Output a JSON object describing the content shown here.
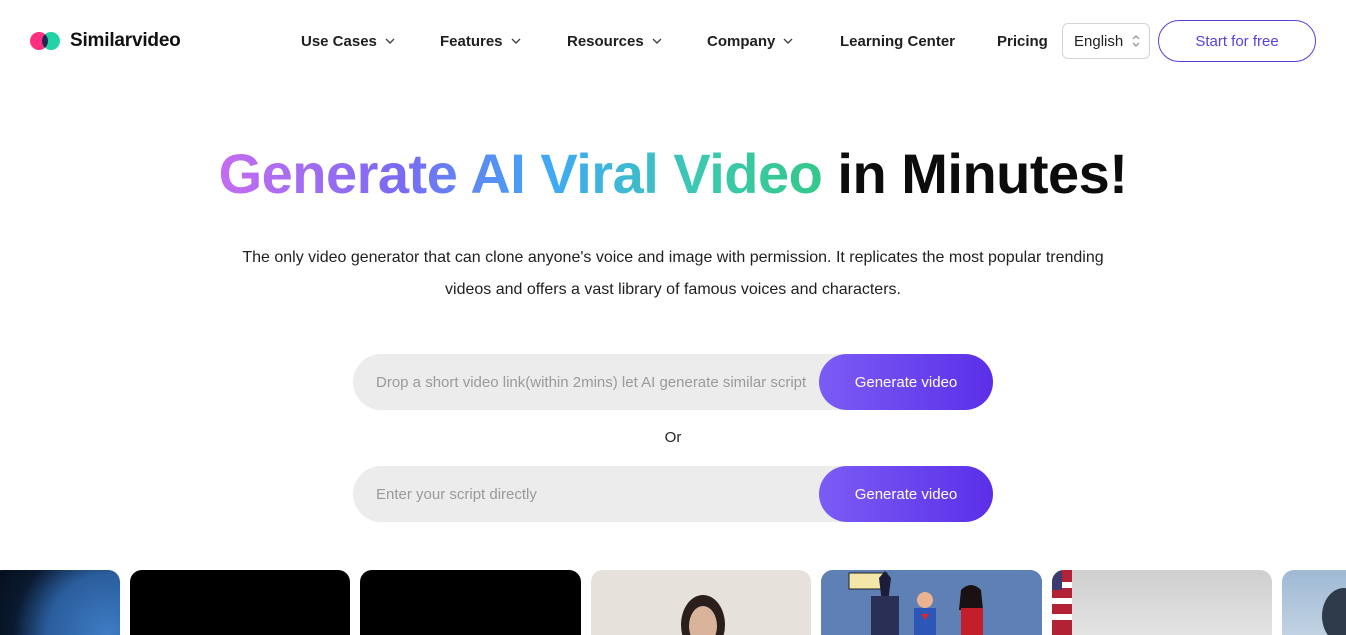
{
  "brand": {
    "name": "Similarvideo"
  },
  "nav": {
    "items": [
      {
        "label": "Use Cases",
        "has_dropdown": true
      },
      {
        "label": "Features",
        "has_dropdown": true
      },
      {
        "label": "Resources",
        "has_dropdown": true
      },
      {
        "label": "Company",
        "has_dropdown": true
      },
      {
        "label": "Learning Center",
        "has_dropdown": false
      },
      {
        "label": "Pricing",
        "has_dropdown": false
      }
    ],
    "language": "English",
    "cta_label": "Start for free"
  },
  "hero": {
    "title_parts": [
      "Generate",
      "AI",
      "Viral",
      "Video",
      "in Minutes!"
    ],
    "subtitle_line1": "The only video generator that can clone anyone's voice and image with permission. It replicates the most popular trending",
    "subtitle_line2": "videos and offers a vast library of famous voices and characters."
  },
  "form": {
    "link_placeholder": "Drop a short video link(within 2mins) let AI generate similar script",
    "script_placeholder": "Enter your script directly",
    "generate_label": "Generate video",
    "or_label": "Or"
  },
  "colors": {
    "accent": "#5b3fd9",
    "button_gradient_start": "#7b5cf5",
    "button_gradient_end": "#5b2fe8",
    "logo_pink": "#ff2e7e",
    "logo_green": "#22d3a6"
  }
}
